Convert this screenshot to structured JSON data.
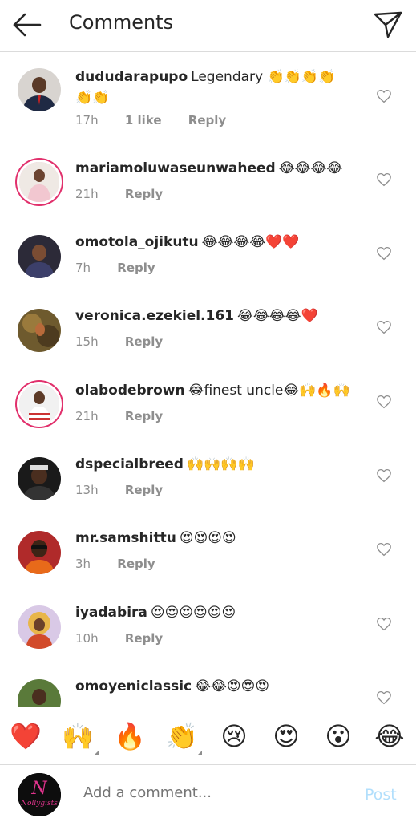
{
  "header": {
    "title": "Comments"
  },
  "comments": [
    {
      "user": "dududarapupo",
      "text": "Legendary 👏👏👏👏👏👏",
      "time": "17h",
      "likes": "1 like",
      "reply": "Reply"
    },
    {
      "user": "mariamoluwaseunwaheed",
      "text": "😂😂😂😂",
      "time": "21h",
      "reply": "Reply"
    },
    {
      "user": "omotola_ojikutu",
      "text": "😂😂😂😂❤️❤️",
      "time": "7h",
      "reply": "Reply"
    },
    {
      "user": "veronica.ezekiel.161",
      "text": "😂😂😂😂❤️",
      "time": "15h",
      "reply": "Reply"
    },
    {
      "user": "olabodebrown",
      "text": "😂finest uncle😂🙌🔥🙌",
      "time": "21h",
      "reply": "Reply"
    },
    {
      "user": "dspecialbreed",
      "text": "🙌🙌🙌🙌",
      "time": "13h",
      "reply": "Reply"
    },
    {
      "user": "mr.samshittu",
      "text": "😍😍😍😍",
      "time": "3h",
      "reply": "Reply"
    },
    {
      "user": "iyadabira",
      "text": "😍😍😍😍😍😍",
      "time": "10h",
      "reply": "Reply"
    },
    {
      "user": "omoyeniclassic",
      "text": "😂😂😍😍😍",
      "time": "",
      "reply": ""
    }
  ],
  "emoji_bar": [
    "❤️",
    "🙌",
    "🔥",
    "👏",
    "😢",
    "😍",
    "😮",
    "😂"
  ],
  "composer": {
    "placeholder": "Add a comment...",
    "post_label": "Post"
  },
  "colors": {
    "story_ring": "#e1306c",
    "post_disabled": "#b2dffc",
    "secondary_text": "#8e8e8e"
  }
}
